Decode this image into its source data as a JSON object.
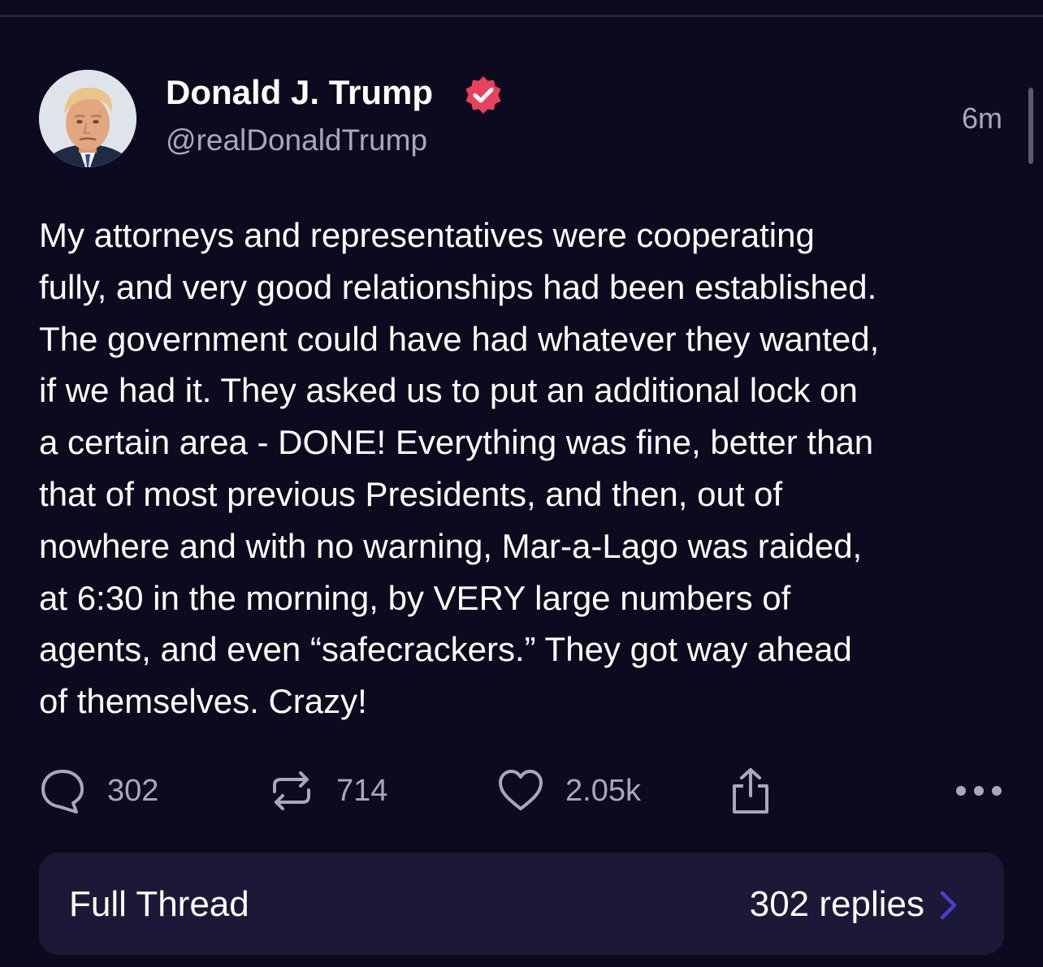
{
  "author": {
    "display_name": "Donald J. Trump",
    "handle": "@realDonaldTrump",
    "verified_icon": "verified-badge-icon"
  },
  "post": {
    "timestamp": "6m",
    "text": "My attorneys and representatives were cooperating\nfully, and very good relationships had been established.\nThe government could have had whatever they wanted,\nif we had it. They asked us to put an additional lock on\na certain area - DONE! Everything was fine, better than\nthat of most previous Presidents, and then, out of\nnowhere and with no warning, Mar-a-Lago was raided,\nat 6:30 in the morning, by VERY large numbers of\nagents, and even “safecrackers.” They got way ahead\nof themselves. Crazy!"
  },
  "actions": {
    "replies": "302",
    "reposts": "714",
    "likes": "2.05k",
    "icons": [
      "reply-icon",
      "repost-icon",
      "heart-icon",
      "share-icon",
      "more-icon"
    ]
  },
  "thread": {
    "label": "Full Thread",
    "replies_label": "302 replies"
  },
  "colors": {
    "background": "#0d0a1f",
    "card": "#1b1838",
    "muted_text": "#aaa7bd",
    "verified_badge": "#e8415d",
    "chevron": "#4a3fc7"
  }
}
